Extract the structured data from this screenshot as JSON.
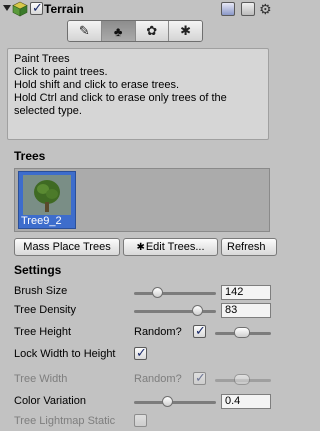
{
  "header": {
    "title": "Terrain",
    "enabled": true,
    "icons": [
      "foldout-arrow-icon",
      "terrain-cube-icon",
      "book-icon",
      "gear-icon"
    ]
  },
  "tabs": [
    {
      "name": "paint-texture-icon",
      "glyph": "✎",
      "active": false
    },
    {
      "name": "paint-trees-icon",
      "glyph": "♣",
      "active": true
    },
    {
      "name": "paint-details-icon",
      "glyph": "✿",
      "active": false
    },
    {
      "name": "settings-gear-icon",
      "glyph": "✱",
      "active": false
    }
  ],
  "help": {
    "title": "Paint Trees",
    "line1": "Click to paint trees.",
    "line2": "Hold shift and click to erase trees.",
    "line3": "Hold Ctrl and click to erase only trees of the selected type."
  },
  "trees": {
    "heading": "Trees",
    "items": [
      {
        "label": "Tree9_2",
        "selected": true
      }
    ]
  },
  "buttons": {
    "mass_place": "Mass Place Trees",
    "edit_trees": "Edit Trees...",
    "refresh": "Refresh"
  },
  "settings": {
    "heading": "Settings",
    "brush_size": {
      "label": "Brush Size",
      "value": "142"
    },
    "tree_density": {
      "label": "Tree Density",
      "value": "83"
    },
    "tree_height": {
      "label": "Tree Height",
      "random_label": "Random?",
      "random": true
    },
    "lock_width": {
      "label": "Lock Width to Height",
      "checked": true
    },
    "tree_width": {
      "label": "Tree Width",
      "random_label": "Random?",
      "random": true,
      "disabled": true
    },
    "color_variation": {
      "label": "Color Variation",
      "value": "0.4"
    },
    "lightmap_static": {
      "label": "Tree Lightmap Static",
      "checked": false,
      "disabled": true
    }
  }
}
